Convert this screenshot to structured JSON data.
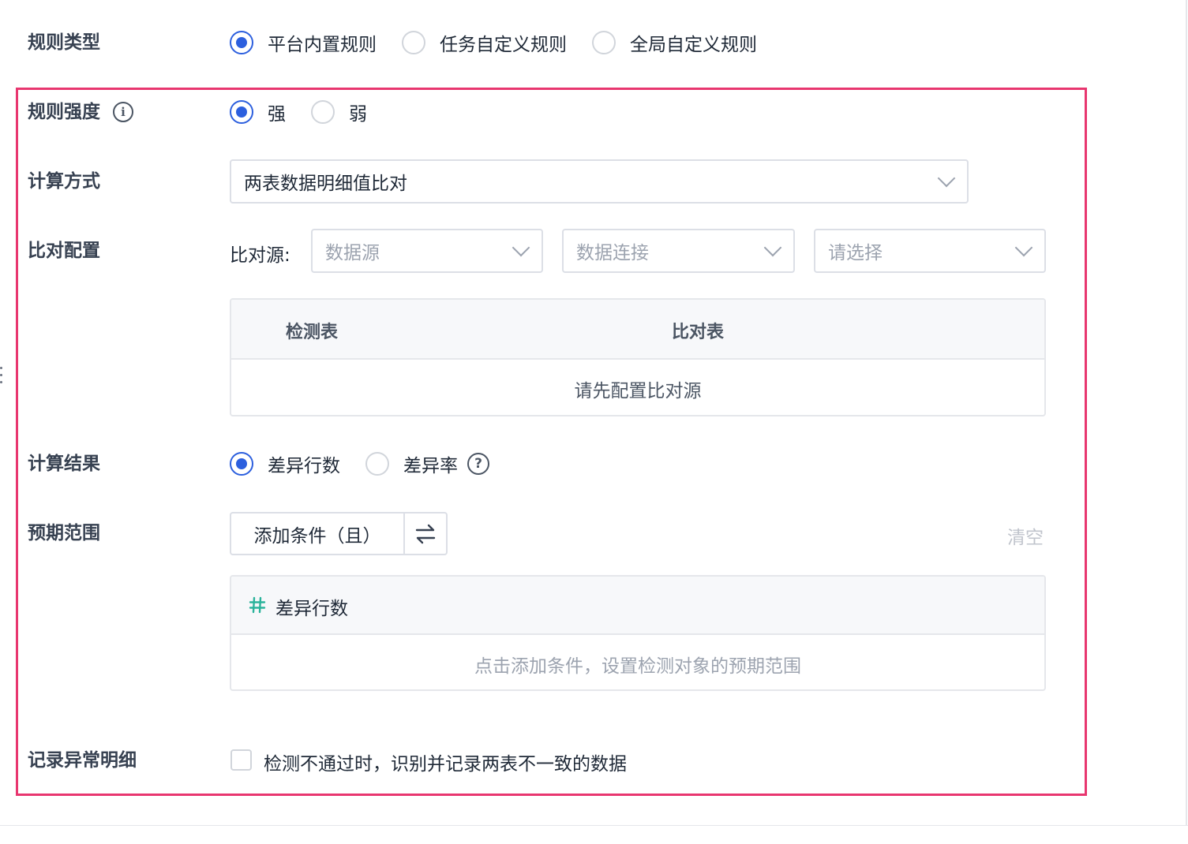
{
  "rule_type": {
    "label": "规则类型",
    "options": [
      "平台内置规则",
      "任务自定义规则",
      "全局自定义规则"
    ],
    "selected_index": 0
  },
  "rule_strength": {
    "label": "规则强度",
    "options": [
      "强",
      "弱"
    ],
    "selected_index": 0
  },
  "calc_method": {
    "label": "计算方式",
    "value": "两表数据明细值比对"
  },
  "compare_config": {
    "label": "比对配置",
    "source_label": "比对源:",
    "selects": [
      {
        "placeholder": "数据源"
      },
      {
        "placeholder": "数据连接"
      },
      {
        "placeholder": "请选择"
      }
    ],
    "table": {
      "headers": [
        "检测表",
        "比对表"
      ],
      "empty_text": "请先配置比对源"
    }
  },
  "calc_result": {
    "label": "计算结果",
    "options": [
      "差异行数",
      "差异率"
    ],
    "selected_index": 0
  },
  "expected_range": {
    "label": "预期范围",
    "add_condition_label": "添加条件（且）",
    "clear_label": "清空",
    "metric_name": "差异行数",
    "empty_text": "点击添加条件，设置检测对象的预期范围"
  },
  "record_detail": {
    "label": "记录异常明细",
    "checkbox_text": "检测不通过时，识别并记录两表不一致的数据",
    "checked": false
  },
  "colors": {
    "primary": "#2c5fde",
    "highlight_border": "#e8366f",
    "metric_icon": "#2bb39b"
  }
}
